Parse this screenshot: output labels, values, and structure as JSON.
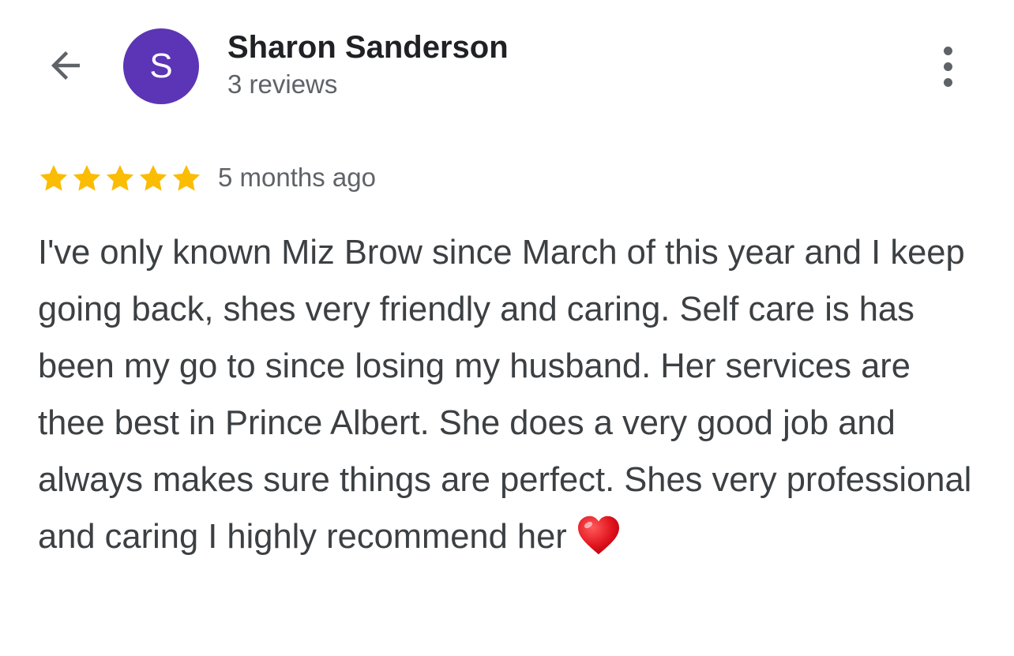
{
  "header": {
    "back_icon": "arrow-left-icon",
    "avatar_letter": "S",
    "avatar_color": "#5b35b5",
    "reviewer_name": "Sharon Sanderson",
    "review_count": "3 reviews",
    "more_icon": "more-vertical-icon"
  },
  "review": {
    "rating": 5,
    "rating_max": 5,
    "star_color": "#fbbc04",
    "time": "5 months ago",
    "text": "I've only known Miz Brow since March of this year and I keep going back, shes very friendly and caring. Self care is has been my go to since losing my husband. Her services are thee best in Prince Albert. She does a very good job and always makes sure things are perfect. Shes very professional and caring I highly recommend her",
    "emoji_icon": "red-heart-icon"
  },
  "colors": {
    "icon_gray": "#5f6368",
    "text_dark": "#202124",
    "text_body": "#3c4043"
  }
}
